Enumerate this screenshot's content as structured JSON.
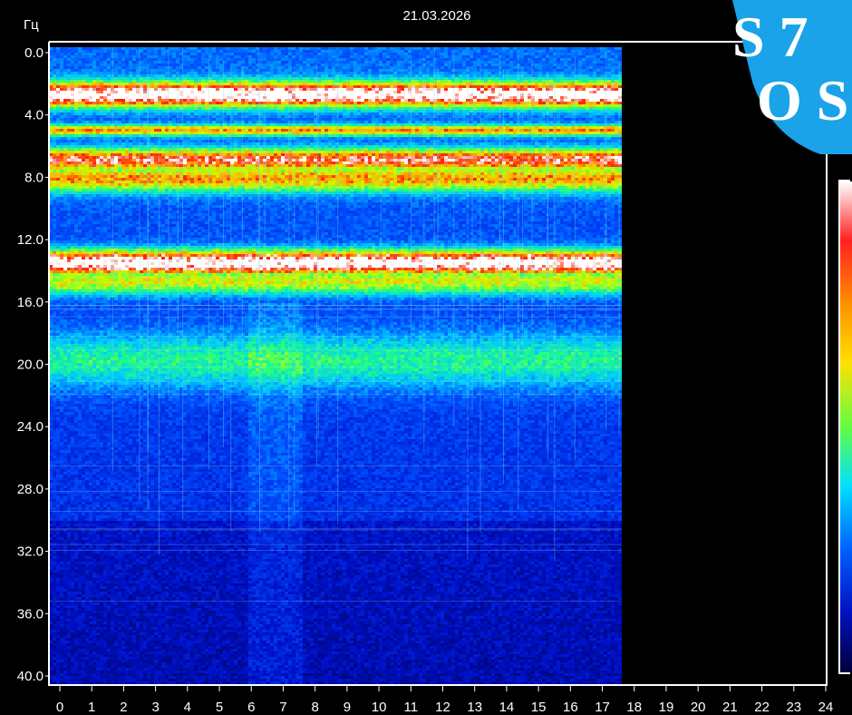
{
  "chart_data": {
    "type": "heatmap",
    "title": "21.03.2026",
    "ylabel": "Гц",
    "xlabel": "",
    "xlim": [
      0,
      24
    ],
    "ylim": [
      0,
      40
    ],
    "y_inverted": true,
    "data_end_x": 17.6,
    "x_ticks": [
      "0",
      "1",
      "2",
      "3",
      "4",
      "5",
      "6",
      "7",
      "8",
      "9",
      "10",
      "11",
      "12",
      "13",
      "14",
      "15",
      "16",
      "17",
      "18",
      "19",
      "20",
      "21",
      "22",
      "23",
      "24"
    ],
    "y_ticks": [
      "0.0",
      "4.0",
      "8.0",
      "12.0",
      "16.0",
      "20.0",
      "24.0",
      "28.0",
      "32.0",
      "36.0",
      "40.0"
    ],
    "colorscale": [
      "#00004a",
      "#0010c8",
      "#0050ff",
      "#00c8ff",
      "#20ff80",
      "#c8ff00",
      "#ffb000",
      "#ff2000",
      "#ffffff"
    ],
    "bands": [
      {
        "center_hz": 2.6,
        "width_hz": 1.1,
        "intensity": 0.92
      },
      {
        "center_hz": 4.9,
        "width_hz": 0.5,
        "intensity": 0.55
      },
      {
        "center_hz": 6.8,
        "width_hz": 1.0,
        "intensity": 0.72
      },
      {
        "center_hz": 8.0,
        "width_hz": 1.2,
        "intensity": 0.55
      },
      {
        "center_hz": 13.4,
        "width_hz": 1.1,
        "intensity": 0.95
      },
      {
        "center_hz": 14.6,
        "width_hz": 1.2,
        "intensity": 0.45
      },
      {
        "center_hz": 19.7,
        "width_hz": 2.5,
        "intensity": 0.28
      }
    ]
  },
  "logo": {
    "text_line1": "S 7",
    "text_line2": "O S",
    "color": "#1aa3e8"
  }
}
